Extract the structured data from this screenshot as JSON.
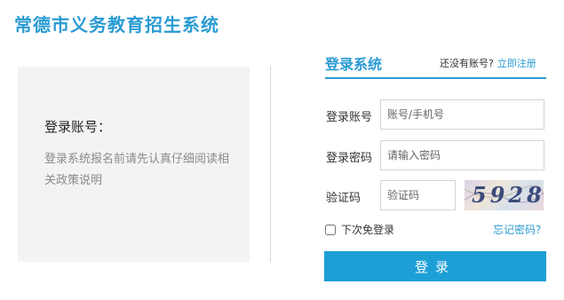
{
  "header": {
    "title": "常德市义务教育招生系统"
  },
  "info_panel": {
    "heading": "登录账号：",
    "text": "登录系统报名前请先认真仔细阅读相关政策说明"
  },
  "login": {
    "title": "登录系统",
    "no_account_text": "还没有账号?",
    "register_link": "立即注册",
    "account_label": "登录账号",
    "account_placeholder": "账号/手机号",
    "password_label": "登录密码",
    "password_placeholder": "请输入密码",
    "captcha_label": "验证码",
    "captcha_placeholder": "验证码",
    "captcha_text": "5928",
    "remember_label": "下次免登录",
    "forgot_link": "忘记密码?",
    "button_label": "登录",
    "accent_color": "#2a9bd3"
  }
}
